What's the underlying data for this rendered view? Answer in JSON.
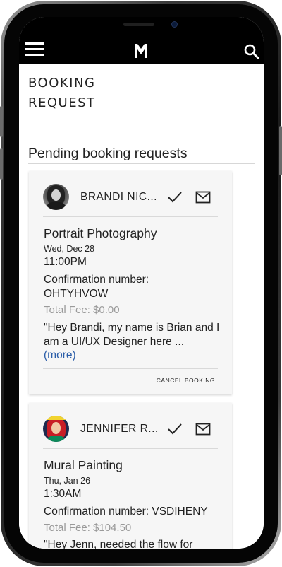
{
  "header": {
    "menu_icon": "hamburger-menu-icon",
    "logo_icon": "brand-logo-icon",
    "search_icon": "search-icon"
  },
  "page": {
    "title_line1": "BOOKING",
    "title_line2": "REQUEST",
    "section_title": "Pending booking requests"
  },
  "requests": [
    {
      "name": "BRANDI NIC...",
      "service": "Portrait Photography",
      "date": "Wed, Dec 28",
      "time": "11:00PM",
      "confirmation_label": "Confirmation number:",
      "confirmation_number": "OHTYHVOW",
      "fee": "Total Fee: $0.00",
      "message": "\"Hey Brandi, my name is Brian and I am a UI/UX Designer here ...",
      "more": "(more)",
      "cancel": "CANCEL BOOKING"
    },
    {
      "name": "JENNIFER R...",
      "service": "Mural Painting",
      "date": "Thu, Jan 26",
      "time": "1:30AM",
      "confirmation_label": "Confirmation number:",
      "confirmation_number": "VSDIHENY",
      "fee": "Total Fee: $104.50",
      "message": "\"Hey Jenn, needed the flow for"
    }
  ],
  "colors": {
    "app_bar": "#000000",
    "link": "#2a5da8",
    "muted_text": "#9a9a9a",
    "card_background": "#f6f6f6"
  }
}
